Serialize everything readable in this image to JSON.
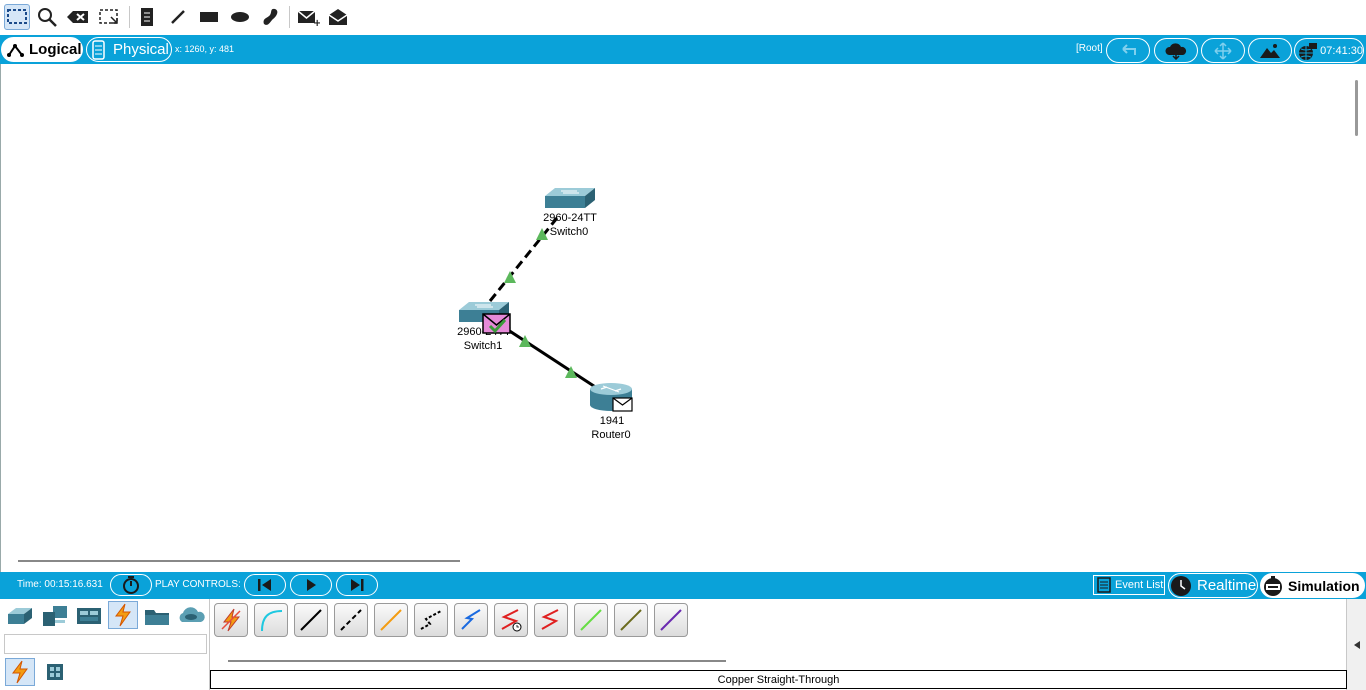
{
  "toolbar": {
    "tools": [
      "select-icon",
      "zoom-icon",
      "delete-icon",
      "resize-icon",
      "note-icon",
      "line-icon",
      "rectangle-icon",
      "ellipse-icon",
      "freeform-icon",
      "add-simple-pdu-icon",
      "add-complex-pdu-icon"
    ]
  },
  "topbar": {
    "logical_label": "Logical",
    "physical_label": "Physical",
    "coords": "x: 1260, y: 481",
    "root_label": "[Root]",
    "clock": "07:41:30"
  },
  "devices": {
    "switch0": {
      "model": "2960-24TT",
      "name": "Switch0"
    },
    "switch1": {
      "model": "2960-24TT",
      "name": "Switch1"
    },
    "router0": {
      "model": "1941",
      "name": "Router0"
    }
  },
  "simbar": {
    "time": "Time: 00:15:16.631",
    "play_controls": "PLAY CONTROLS:",
    "event_list": "Event List",
    "realtime": "Realtime",
    "simulation": "Simulation"
  },
  "status": {
    "selected_connection": "Copper Straight-Through"
  },
  "colors": {
    "accent": "#0aa2d9",
    "link_ok": "#5cb85c"
  }
}
